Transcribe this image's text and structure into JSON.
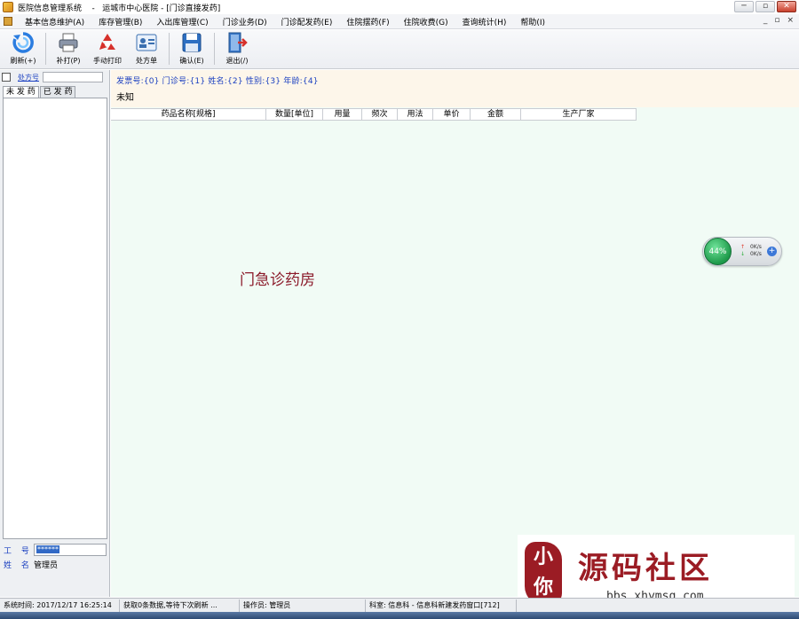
{
  "window": {
    "title": "医院信息管理系统    -   运城市中心医院 - [门诊直接发药]",
    "buttons": [
      "─",
      "▫",
      "✕"
    ]
  },
  "menubar": {
    "items": [
      "基本信息维护(A)",
      "库存管理(B)",
      "入出库管理(C)",
      "门诊业务(D)",
      "门诊配发药(E)",
      "住院摆药(F)",
      "住院收费(G)",
      "查询统计(H)",
      "帮助(I)"
    ],
    "mdi_buttons": [
      "_",
      "▫",
      "×"
    ]
  },
  "toolbar": {
    "buttons": [
      {
        "label": "刷新(+)",
        "icon": "refresh-icon"
      },
      {
        "label": "补打(P)",
        "icon": "printer-icon"
      },
      {
        "label": "手动打印",
        "icon": "recycle-icon"
      },
      {
        "label": "处方单",
        "icon": "id-card-icon"
      },
      {
        "label": "确认(E)",
        "icon": "save-disk-icon"
      },
      {
        "label": "退出(/)",
        "icon": "exit-door-icon"
      }
    ]
  },
  "left": {
    "link": "处方号",
    "tabs": [
      "未 发 药",
      "已 发 药"
    ],
    "staff_id_label": "工  号",
    "staff_id_value": "******",
    "name_label": "姓  名",
    "name_value": "管理员"
  },
  "main": {
    "info_line": "发票号:{0} 门诊号:{1} 姓名:{2} 性别:{3} 年龄:{4}",
    "status_text": "未知",
    "columns": [
      "药品名称[规格]",
      "数量[单位]",
      "用量",
      "频次",
      "用法",
      "单价",
      "金额",
      "生产厂家"
    ],
    "pharmacy_label": "门急诊药房"
  },
  "widget": {
    "percent": "44%",
    "up_speed": "0K/s",
    "down_speed": "0K/s",
    "plus": "+"
  },
  "logo": {
    "seal_text": "小 你",
    "brand": "源码社区",
    "site": "bbs.xhymsq.com"
  },
  "statusbar": {
    "time": "系统时间: 2017/12/17 16:25:14",
    "message": "获取0条数据,等待下次刷新 ...",
    "operator": "操作员: 管理员",
    "department": "科室: 信息科 - 信息科新建发药窗口[712]"
  },
  "colors": {
    "accent_blue": "#1a3fc0",
    "panel_bg": "#f1fbf5",
    "brand_red": "#9b1c24"
  }
}
